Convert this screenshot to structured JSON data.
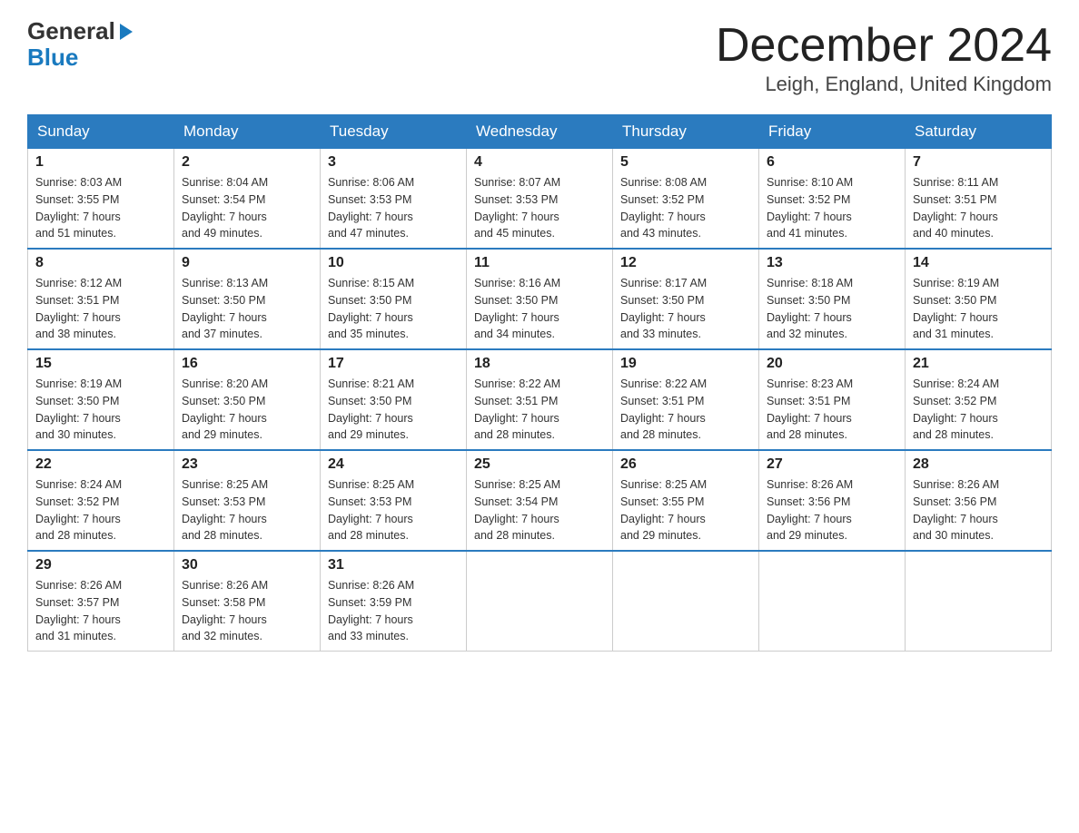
{
  "header": {
    "logo_line1": "General",
    "logo_line2": "Blue",
    "month_title": "December 2024",
    "location": "Leigh, England, United Kingdom"
  },
  "days_of_week": [
    "Sunday",
    "Monday",
    "Tuesday",
    "Wednesday",
    "Thursday",
    "Friday",
    "Saturday"
  ],
  "weeks": [
    [
      {
        "day": "1",
        "info": "Sunrise: 8:03 AM\nSunset: 3:55 PM\nDaylight: 7 hours\nand 51 minutes."
      },
      {
        "day": "2",
        "info": "Sunrise: 8:04 AM\nSunset: 3:54 PM\nDaylight: 7 hours\nand 49 minutes."
      },
      {
        "day": "3",
        "info": "Sunrise: 8:06 AM\nSunset: 3:53 PM\nDaylight: 7 hours\nand 47 minutes."
      },
      {
        "day": "4",
        "info": "Sunrise: 8:07 AM\nSunset: 3:53 PM\nDaylight: 7 hours\nand 45 minutes."
      },
      {
        "day": "5",
        "info": "Sunrise: 8:08 AM\nSunset: 3:52 PM\nDaylight: 7 hours\nand 43 minutes."
      },
      {
        "day": "6",
        "info": "Sunrise: 8:10 AM\nSunset: 3:52 PM\nDaylight: 7 hours\nand 41 minutes."
      },
      {
        "day": "7",
        "info": "Sunrise: 8:11 AM\nSunset: 3:51 PM\nDaylight: 7 hours\nand 40 minutes."
      }
    ],
    [
      {
        "day": "8",
        "info": "Sunrise: 8:12 AM\nSunset: 3:51 PM\nDaylight: 7 hours\nand 38 minutes."
      },
      {
        "day": "9",
        "info": "Sunrise: 8:13 AM\nSunset: 3:50 PM\nDaylight: 7 hours\nand 37 minutes."
      },
      {
        "day": "10",
        "info": "Sunrise: 8:15 AM\nSunset: 3:50 PM\nDaylight: 7 hours\nand 35 minutes."
      },
      {
        "day": "11",
        "info": "Sunrise: 8:16 AM\nSunset: 3:50 PM\nDaylight: 7 hours\nand 34 minutes."
      },
      {
        "day": "12",
        "info": "Sunrise: 8:17 AM\nSunset: 3:50 PM\nDaylight: 7 hours\nand 33 minutes."
      },
      {
        "day": "13",
        "info": "Sunrise: 8:18 AM\nSunset: 3:50 PM\nDaylight: 7 hours\nand 32 minutes."
      },
      {
        "day": "14",
        "info": "Sunrise: 8:19 AM\nSunset: 3:50 PM\nDaylight: 7 hours\nand 31 minutes."
      }
    ],
    [
      {
        "day": "15",
        "info": "Sunrise: 8:19 AM\nSunset: 3:50 PM\nDaylight: 7 hours\nand 30 minutes."
      },
      {
        "day": "16",
        "info": "Sunrise: 8:20 AM\nSunset: 3:50 PM\nDaylight: 7 hours\nand 29 minutes."
      },
      {
        "day": "17",
        "info": "Sunrise: 8:21 AM\nSunset: 3:50 PM\nDaylight: 7 hours\nand 29 minutes."
      },
      {
        "day": "18",
        "info": "Sunrise: 8:22 AM\nSunset: 3:51 PM\nDaylight: 7 hours\nand 28 minutes."
      },
      {
        "day": "19",
        "info": "Sunrise: 8:22 AM\nSunset: 3:51 PM\nDaylight: 7 hours\nand 28 minutes."
      },
      {
        "day": "20",
        "info": "Sunrise: 8:23 AM\nSunset: 3:51 PM\nDaylight: 7 hours\nand 28 minutes."
      },
      {
        "day": "21",
        "info": "Sunrise: 8:24 AM\nSunset: 3:52 PM\nDaylight: 7 hours\nand 28 minutes."
      }
    ],
    [
      {
        "day": "22",
        "info": "Sunrise: 8:24 AM\nSunset: 3:52 PM\nDaylight: 7 hours\nand 28 minutes."
      },
      {
        "day": "23",
        "info": "Sunrise: 8:25 AM\nSunset: 3:53 PM\nDaylight: 7 hours\nand 28 minutes."
      },
      {
        "day": "24",
        "info": "Sunrise: 8:25 AM\nSunset: 3:53 PM\nDaylight: 7 hours\nand 28 minutes."
      },
      {
        "day": "25",
        "info": "Sunrise: 8:25 AM\nSunset: 3:54 PM\nDaylight: 7 hours\nand 28 minutes."
      },
      {
        "day": "26",
        "info": "Sunrise: 8:25 AM\nSunset: 3:55 PM\nDaylight: 7 hours\nand 29 minutes."
      },
      {
        "day": "27",
        "info": "Sunrise: 8:26 AM\nSunset: 3:56 PM\nDaylight: 7 hours\nand 29 minutes."
      },
      {
        "day": "28",
        "info": "Sunrise: 8:26 AM\nSunset: 3:56 PM\nDaylight: 7 hours\nand 30 minutes."
      }
    ],
    [
      {
        "day": "29",
        "info": "Sunrise: 8:26 AM\nSunset: 3:57 PM\nDaylight: 7 hours\nand 31 minutes."
      },
      {
        "day": "30",
        "info": "Sunrise: 8:26 AM\nSunset: 3:58 PM\nDaylight: 7 hours\nand 32 minutes."
      },
      {
        "day": "31",
        "info": "Sunrise: 8:26 AM\nSunset: 3:59 PM\nDaylight: 7 hours\nand 33 minutes."
      },
      {
        "day": "",
        "info": ""
      },
      {
        "day": "",
        "info": ""
      },
      {
        "day": "",
        "info": ""
      },
      {
        "day": "",
        "info": ""
      }
    ]
  ]
}
